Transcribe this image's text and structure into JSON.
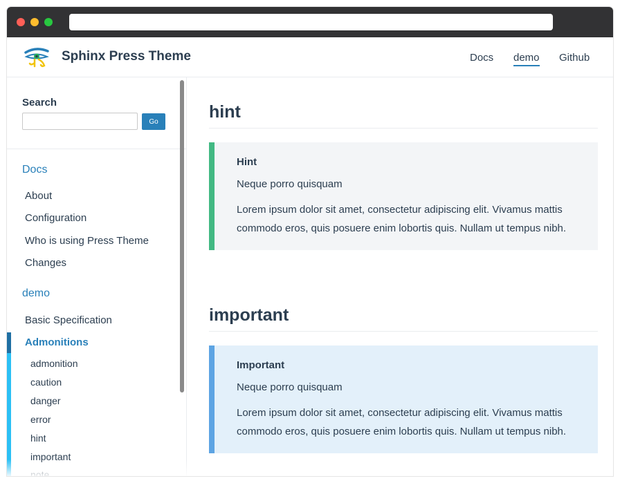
{
  "navbar": {
    "site_title": "Sphinx Press Theme",
    "links": [
      {
        "label": "Docs"
      },
      {
        "label": "demo",
        "active": true
      },
      {
        "label": "Github"
      }
    ]
  },
  "sidebar": {
    "search_label": "Search",
    "search_value": "",
    "go_label": "Go",
    "sections": [
      {
        "title": "Docs",
        "items": [
          "About",
          "Configuration",
          "Who is using Press Theme",
          "Changes"
        ]
      },
      {
        "title": "demo",
        "items": [
          "Basic Specification",
          "Admonitions"
        ],
        "active_item": "Admonitions",
        "sub_items": [
          "admonition",
          "caution",
          "danger",
          "error",
          "hint",
          "important",
          "note"
        ]
      }
    ]
  },
  "main": {
    "sections": [
      {
        "heading": "hint",
        "admonition_title": "Hint",
        "para1": "Neque porro quisquam",
        "para2": "Lorem ipsum dolor sit amet, consectetur adipiscing elit. Vivamus mattis commodo eros, quis posuere enim lobortis quis. Nullam ut tempus nibh."
      },
      {
        "heading": "important",
        "admonition_title": "Important",
        "para1": "Neque porro quisquam",
        "para2": "Lorem ipsum dolor sit amet, consectetur adipiscing elit. Vivamus mattis commodo eros, quis posuere enim lobortis quis. Nullam ut tempus nibh."
      }
    ]
  },
  "colors": {
    "accent": "#2980b9",
    "hint_border": "#42b983",
    "important_border": "#5da4e3"
  },
  "icons": [
    "eye-of-horus-logo-icon"
  ]
}
